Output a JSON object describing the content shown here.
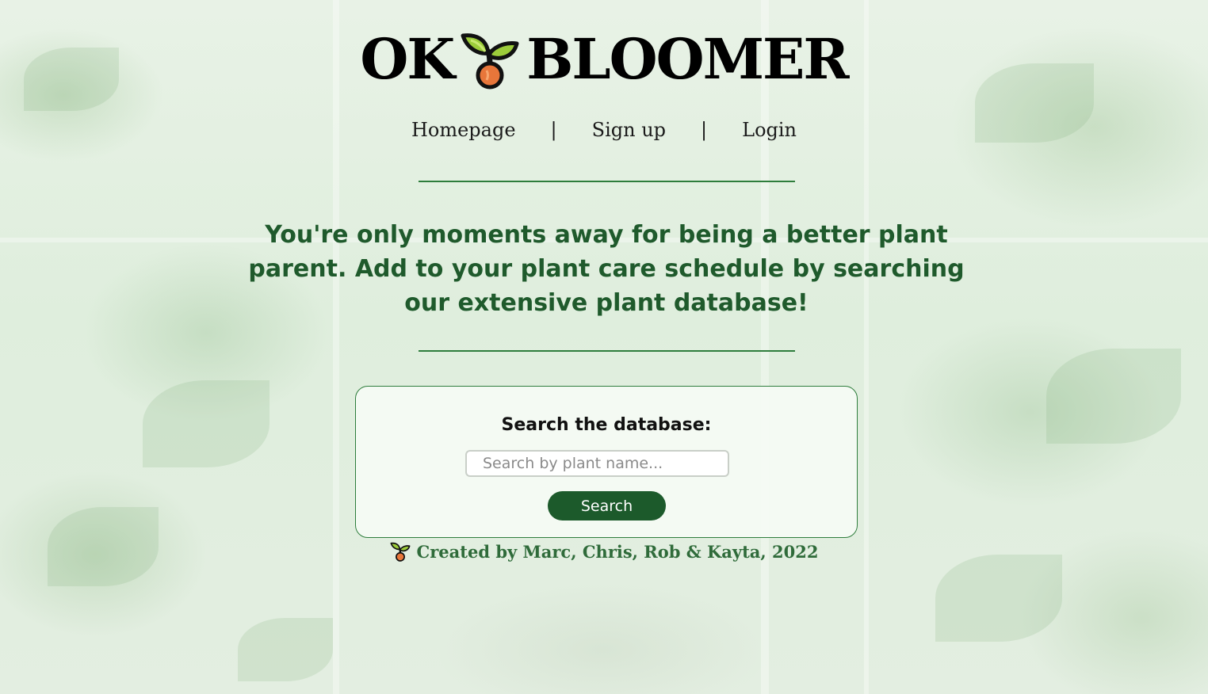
{
  "header": {
    "logo_left": "OK",
    "logo_right": "BLOOMER",
    "logo_icon": "sprout-icon"
  },
  "nav": {
    "items": [
      {
        "label": "Homepage"
      },
      {
        "label": "Sign up"
      },
      {
        "label": "Login"
      }
    ],
    "separator": "|"
  },
  "intro": {
    "text": "You're only moments away for being a better plant parent. Add to your plant care schedule by searching our extensive plant database!"
  },
  "search": {
    "title": "Search the database:",
    "placeholder": "Search by plant name...",
    "button_label": "Search"
  },
  "footer": {
    "icon": "sprout-icon",
    "text": "Created by Marc, Chris, Rob & Kayta, 2022"
  },
  "colors": {
    "accent_green": "#1c5a2b",
    "heading_green": "#1f5a2c",
    "rule_green": "#2e7d3c",
    "sprout_orange": "#e8763a",
    "sprout_leaf": "#9ccc3a"
  }
}
